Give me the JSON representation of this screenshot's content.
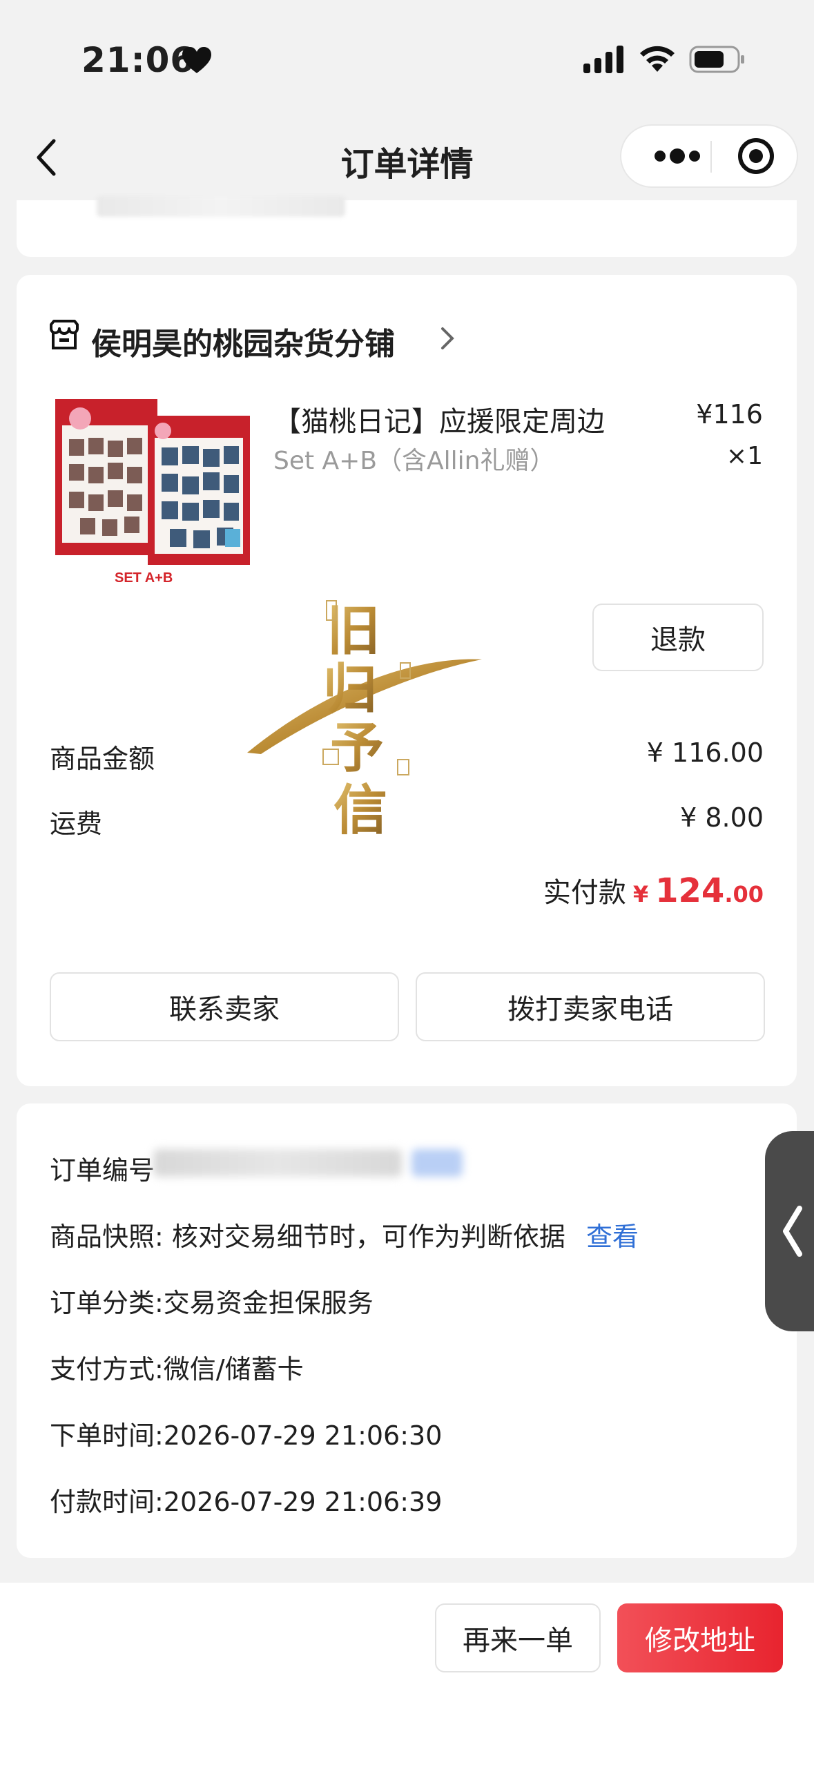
{
  "status_bar": {
    "time": "21:06",
    "icons": [
      "heart-icon",
      "signal-icon",
      "wifi-icon",
      "battery-icon"
    ]
  },
  "nav": {
    "title": "订单详情",
    "icons": [
      "back-chevron-icon",
      "more-dots-icon",
      "target-icon"
    ]
  },
  "shop": {
    "name": "侯明昊的桃园杂货分铺",
    "icon": "shop-icon"
  },
  "product": {
    "title": "【猫桃日记】应援限定周边",
    "spec": "Set A+B（含Allin礼赠）",
    "price": "¥116",
    "qty": "×1",
    "image_label": "SET A+B"
  },
  "buttons": {
    "refund": "退款",
    "contact_seller": "联系卖家",
    "call_seller": "拨打卖家电话",
    "reorder": "再来一单",
    "modify_address": "修改地址"
  },
  "amounts": {
    "goods_label": "商品金额",
    "goods_value": "¥ 116.00",
    "shipping_label": "运费",
    "shipping_value": "¥ 8.00",
    "paid_label": "实付款",
    "paid_currency": "¥",
    "paid_int": "124",
    "paid_dec": ".00"
  },
  "watermark": {
    "text_chars": [
      "旧",
      "归",
      "予",
      "信"
    ]
  },
  "order_info": {
    "order_no_label": "订单编号",
    "snapshot_label": "商品快照: 核对交易细节时，可作为判断依据",
    "snapshot_link": "查看",
    "category": "订单分类:交易资金担保服务",
    "payment": "支付方式:微信/储蓄卡",
    "order_time": "下单时间:2026-07-29 21:06:30",
    "pay_time": "付款时间:2026-07-29 21:06:39"
  },
  "colors": {
    "accent_red": "#e5303a",
    "link_blue": "#2f6fd6",
    "gold": "#b8862b"
  }
}
